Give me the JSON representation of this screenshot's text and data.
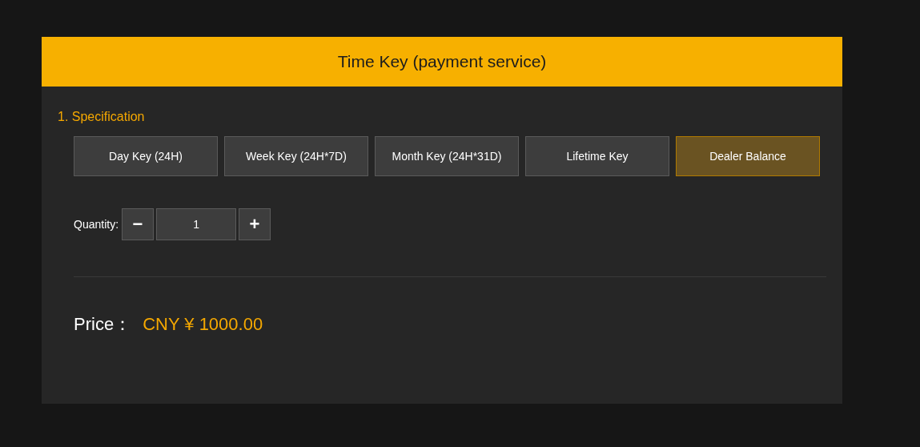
{
  "panel": {
    "title": "Time Key (payment service)"
  },
  "specification": {
    "label": "1. Specification",
    "options": [
      {
        "label": "Day Key (24H)",
        "selected": false
      },
      {
        "label": "Week Key (24H*7D)",
        "selected": false
      },
      {
        "label": "Month Key (24H*31D)",
        "selected": false
      },
      {
        "label": "Lifetime Key",
        "selected": false
      },
      {
        "label": "Dealer Balance",
        "selected": true
      }
    ]
  },
  "quantity": {
    "label": "Quantity:",
    "decrement": "−",
    "value": "1",
    "increment": "+"
  },
  "price": {
    "label": "Price：",
    "value": "CNY ¥ 1000.00"
  }
}
